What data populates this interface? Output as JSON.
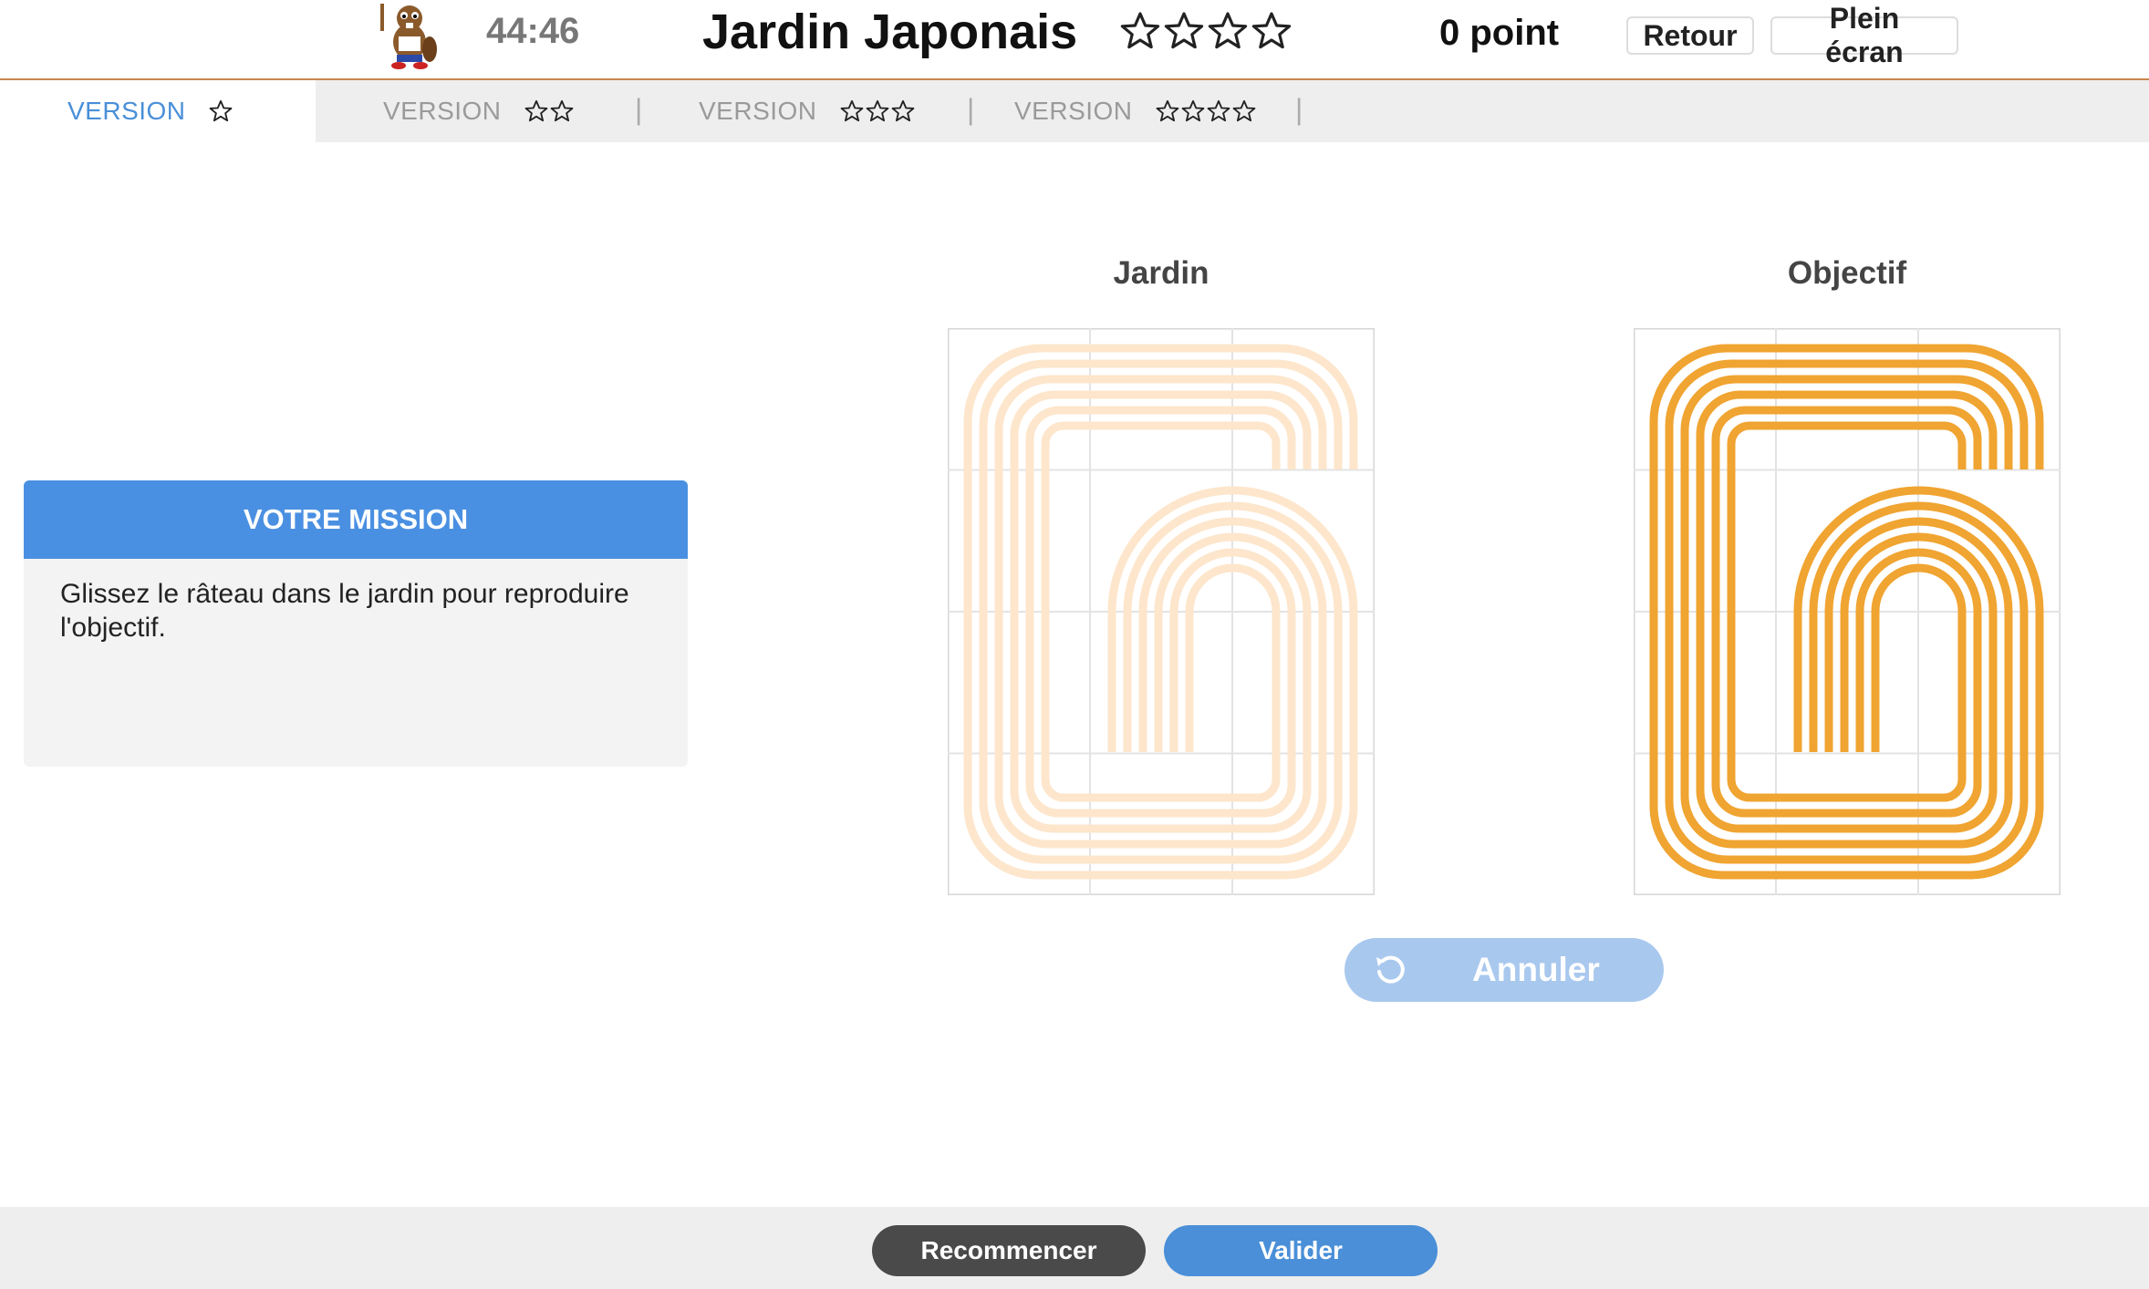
{
  "header": {
    "timer": "44:46",
    "title": "Jardin Japonais",
    "title_star_count": 4,
    "score": "0 point",
    "back_label": "Retour",
    "fullscreen_label": "Plein écran",
    "mascot_icon": "beaver-mascot-icon"
  },
  "tabs": [
    {
      "label": "VERSION",
      "stars": 1,
      "active": true
    },
    {
      "label": "VERSION",
      "stars": 2,
      "active": false
    },
    {
      "label": "VERSION",
      "stars": 3,
      "active": false
    },
    {
      "label": "VERSION",
      "stars": 4,
      "active": false
    }
  ],
  "tab_separator": "|",
  "mission": {
    "title": "VOTRE MISSION",
    "text": "Glissez le râteau dans le jardin pour reproduire l'objectif."
  },
  "boards": {
    "garden_title": "Jardin",
    "target_title": "Objectif",
    "grid_cols": 3,
    "grid_rows": 4
  },
  "colors": {
    "accent": "#4a90e2",
    "rake_target": "#f0a431",
    "rake_faded": "#fde6cc",
    "header_border": "#c9864a",
    "undo_disabled": "#a9c8ee",
    "restart": "#4a4a4a"
  },
  "buttons": {
    "undo_label": "Annuler",
    "undo_icon": "undo-icon",
    "restart_label": "Recommencer",
    "validate_label": "Valider"
  }
}
